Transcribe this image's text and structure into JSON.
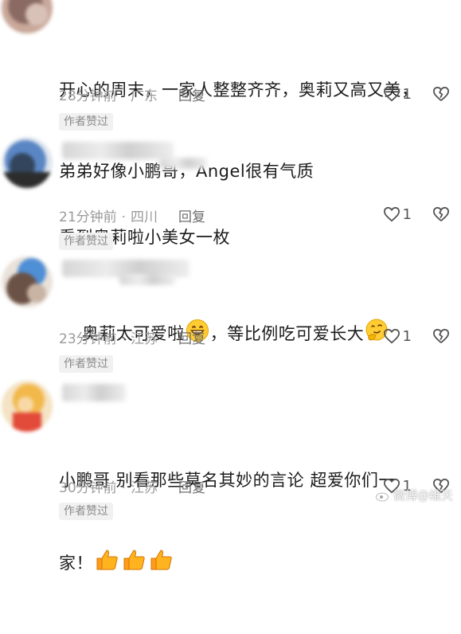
{
  "comments": [
    {
      "text_lines": [
        "开心的周末，一家人整整齐齐，奥莉又高又美，",
        "弟弟好像小鹏哥，Angel很有气质"
      ],
      "time": "28分钟前",
      "location": "广东",
      "reply_label": "回复",
      "likes": "1",
      "badge": "作者赞过"
    },
    {
      "text_lines": [
        "看到奥莉啦小美女一枚"
      ],
      "time": "21分钟前",
      "location": "四川",
      "reply_label": "回复",
      "likes": "1",
      "badge": "作者赞过"
    },
    {
      "text_before_emoji": "奥莉太可爱啦",
      "text_after_emoji": "，等比例吃可爱长大",
      "time": "23分钟前",
      "location": "江苏",
      "reply_label": "回复",
      "likes": "1",
      "badge": "作者赞过"
    },
    {
      "text_line1": "小鹏哥 别看那些莫名其妙的言论 超爱你们一",
      "text_line2": "家！",
      "time": "30分钟前",
      "location": "江苏",
      "reply_label": "回复",
      "likes": "1",
      "badge": "作者赞过"
    }
  ],
  "icons": {
    "like": "heart-outline-icon",
    "dislike": "broken-heart-icon",
    "grin_emoji": "grinning-face-emoji",
    "thinking_emoji": "thinking-face-emoji",
    "thumbs_up_emoji": "thumbs-up-emoji"
  },
  "colors": {
    "text": "#1b1b1b",
    "meta": "#9a9a9a",
    "badge_bg": "#f1f1f1"
  },
  "watermark": "微博@维天"
}
